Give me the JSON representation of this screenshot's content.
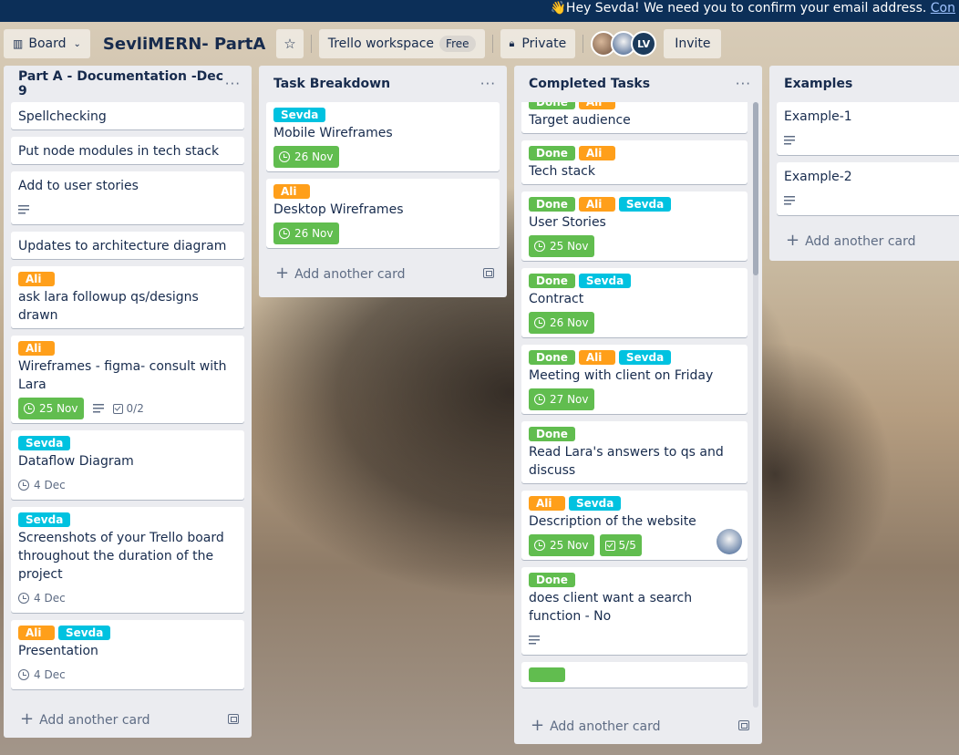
{
  "banner": {
    "message": "👋Hey Sevda! We need you to confirm your email address.",
    "link": "Con"
  },
  "header": {
    "view_switch": "Board",
    "board_title": "SevliMERN- PartA",
    "workspace": "Trello workspace",
    "workspace_badge": "Free",
    "visibility": "Private",
    "member_initials": "LV",
    "invite": "Invite"
  },
  "lists": {
    "partA": {
      "title": "Part A - Documentation -Dec 9",
      "add_card": "Add another card",
      "cards": [
        {
          "title": "Spellchecking"
        },
        {
          "title": "Put node modules in tech stack"
        },
        {
          "title": "Add to user stories"
        },
        {
          "title": "Updates to architecture diagram"
        },
        {
          "labels": [
            "Ali"
          ],
          "title": "ask lara followup qs/designs drawn"
        },
        {
          "labels": [
            "Ali"
          ],
          "title": "Wireframes - figma- consult with Lara",
          "due": "25 Nov",
          "checklist": "0/2"
        },
        {
          "labels": [
            "Sevda"
          ],
          "title": "Dataflow Diagram",
          "due": "4 Dec"
        },
        {
          "labels": [
            "Sevda"
          ],
          "title": "Screenshots of your Trello board throughout the duration of the project",
          "due": "4 Dec"
        },
        {
          "labels": [
            "Ali",
            "Sevda"
          ],
          "title": "Presentation",
          "due": "4 Dec"
        }
      ]
    },
    "task": {
      "title": "Task Breakdown",
      "add_card": "Add another card",
      "cards": [
        {
          "labels": [
            "Sevda"
          ],
          "title": "Mobile Wireframes",
          "due": "26 Nov"
        },
        {
          "labels": [
            "Ali"
          ],
          "title": "Desktop Wireframes",
          "due": "26 Nov"
        }
      ]
    },
    "completed": {
      "title": "Completed Tasks",
      "add_card": "Add another card",
      "cards": [
        {
          "labels": [
            "Done",
            "Ali"
          ],
          "title": "Target audience"
        },
        {
          "labels": [
            "Done",
            "Ali"
          ],
          "title": "Tech stack"
        },
        {
          "labels": [
            "Done",
            "Ali",
            "Sevda"
          ],
          "title": "User Stories",
          "due": "25 Nov"
        },
        {
          "labels": [
            "Done",
            "Sevda"
          ],
          "title": "Contract",
          "due": "26 Nov"
        },
        {
          "labels": [
            "Done",
            "Ali",
            "Sevda"
          ],
          "title": "Meeting with client on Friday",
          "due": "27 Nov"
        },
        {
          "labels": [
            "Done"
          ],
          "title": "Read Lara's answers to qs and discuss"
        },
        {
          "labels": [
            "Ali",
            "Sevda"
          ],
          "title": "Description of the website",
          "due": "25 Nov",
          "checklist": "5/5"
        },
        {
          "labels": [
            "Done"
          ],
          "title": "does client want a search function - No"
        }
      ]
    },
    "examples": {
      "title": "Examples",
      "add_card": "Add another card",
      "cards": [
        {
          "title": "Example-1"
        },
        {
          "title": "Example-2"
        }
      ]
    }
  },
  "colors": {
    "label_done": "#61bd4f",
    "label_ali": "#ff9f1a",
    "label_sevda": "#00c2e0",
    "banner": "#0c2f58",
    "list_bg": "#ebecf0"
  }
}
